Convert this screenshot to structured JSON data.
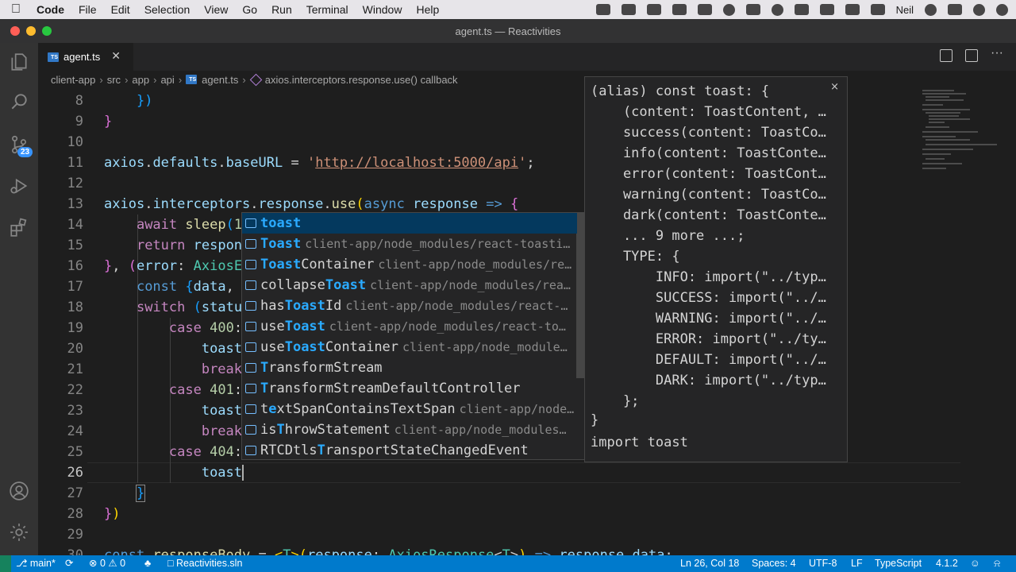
{
  "menubar": {
    "app": "Code",
    "items": [
      "File",
      "Edit",
      "Selection",
      "View",
      "Go",
      "Run",
      "Terminal",
      "Window",
      "Help"
    ],
    "user": "Neil"
  },
  "window": {
    "title": "agent.ts — Reactivities"
  },
  "activity_bar": {
    "source_control_badge": "23"
  },
  "tabs": [
    {
      "label": "agent.ts",
      "icon": "ts"
    }
  ],
  "breadcrumb": {
    "parts": [
      "client-app",
      "src",
      "app",
      "api",
      "agent.ts",
      "axios.interceptors.response.use() callback"
    ]
  },
  "editor": {
    "line_numbers": [
      "8",
      "9",
      "10",
      "11",
      "12",
      "13",
      "14",
      "15",
      "16",
      "17",
      "18",
      "19",
      "20",
      "21",
      "22",
      "23",
      "24",
      "25",
      "26",
      "27",
      "28",
      "29",
      "30"
    ],
    "active_line": "26"
  },
  "suggest": {
    "items": [
      {
        "pre": "",
        "match": "toast",
        "post": "",
        "detail": ""
      },
      {
        "pre": "",
        "match": "Toast",
        "post": "",
        "detail": "client-app/node_modules/react-toasti…"
      },
      {
        "pre": "",
        "match": "Toast",
        "post": "Container",
        "detail": "client-app/node_modules/re…"
      },
      {
        "pre": "collapse",
        "match": "Toast",
        "post": "",
        "detail": "client-app/node_modules/rea…"
      },
      {
        "pre": "has",
        "match": "Toast",
        "post": "Id",
        "detail": "client-app/node_modules/react-…"
      },
      {
        "pre": "use",
        "match": "Toast",
        "post": "",
        "detail": "client-app/node_modules/react-to…"
      },
      {
        "pre": "use",
        "match": "Toast",
        "post": "Container",
        "detail": "client-app/node_module…"
      },
      {
        "pre": "",
        "match": "T",
        "post": "ransformStream",
        "detail": ""
      },
      {
        "pre": "",
        "match": "T",
        "post": "ransformStreamDefaultController",
        "detail": ""
      },
      {
        "pre": "t",
        "match": "e",
        "post": "xtSpanContainsTextSpan",
        "detail": "client-app/node…"
      },
      {
        "pre": "is",
        "match": "T",
        "post": "hrowStatement",
        "detail": "client-app/node_modules…"
      },
      {
        "pre": "RTCDtls",
        "match": "T",
        "post": "ransportStateChangedEvent",
        "detail": ""
      }
    ]
  },
  "docs": {
    "lines": [
      "(alias) const toast: {",
      "    (content: ToastContent, …",
      "    success(content: ToastCo…",
      "    info(content: ToastConte…",
      "    error(content: ToastCont…",
      "    warning(content: ToastCo…",
      "    dark(content: ToastConte…",
      "    ... 9 more ...;",
      "    TYPE: {",
      "        INFO: import(\"../typ…",
      "        SUCCESS: import(\"../…",
      "        WARNING: import(\"../…",
      "        ERROR: import(\"../ty…",
      "        DEFAULT: import(\"../…",
      "        DARK: import(\"../typ…",
      "    };",
      "}",
      "import toast"
    ],
    "close": "×"
  },
  "statusbar": {
    "branch": "main*",
    "errors": "0",
    "warnings": "0",
    "folder": "Reactivities.sln",
    "position": "Ln 26, Col 18",
    "spaces": "Spaces: 4",
    "encoding": "UTF-8",
    "eol": "LF",
    "language": "TypeScript",
    "version": "4.1.2"
  },
  "colors": {
    "status_bar": "#007acc",
    "editor_bg": "#1e1e1e",
    "suggest_match": "#2aaaff"
  }
}
